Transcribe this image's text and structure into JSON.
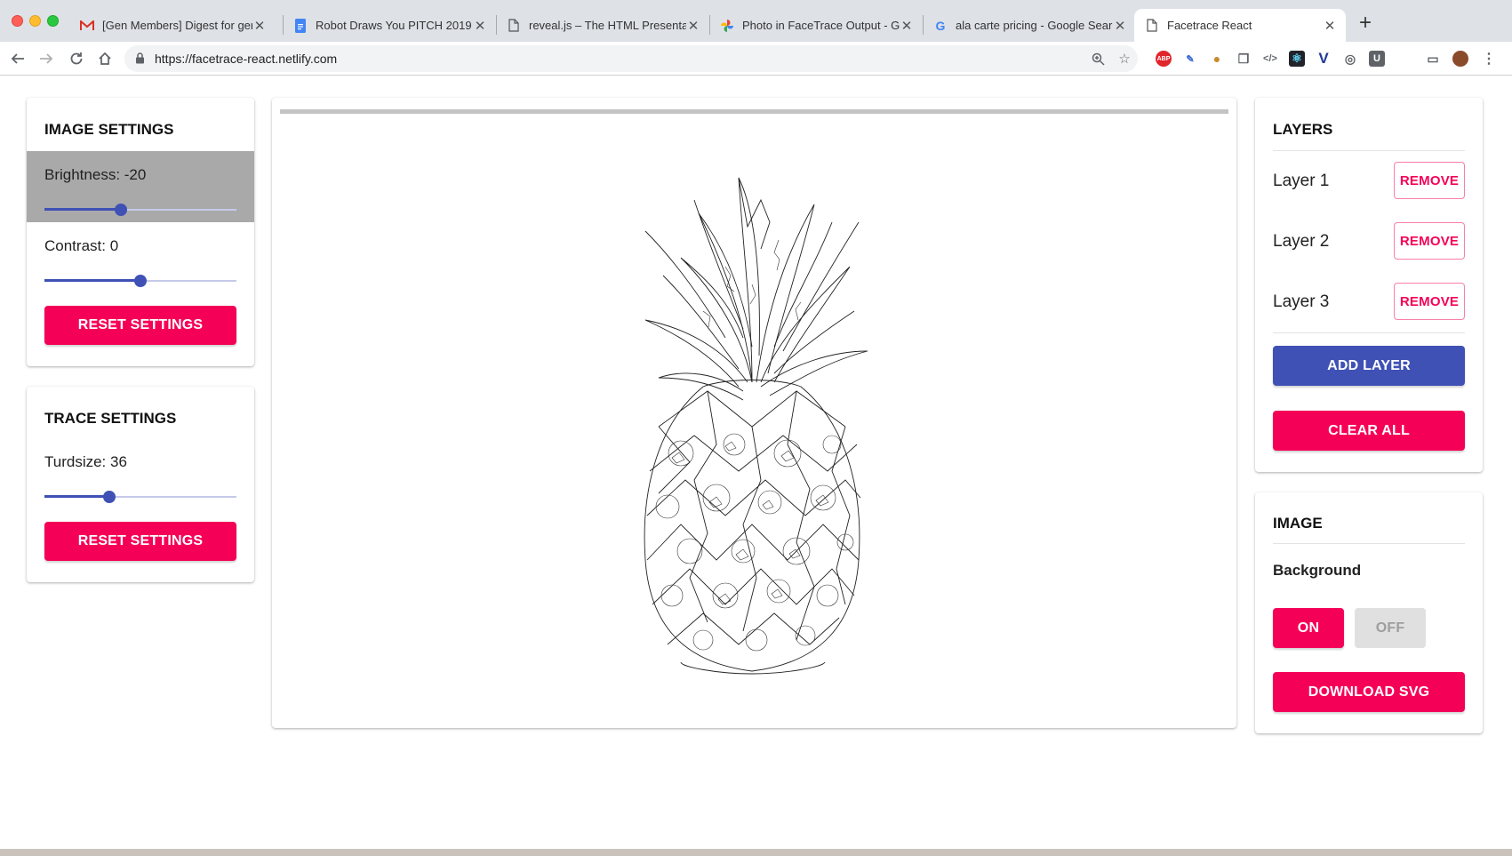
{
  "browser": {
    "tabs": [
      {
        "title": "[Gen Members] Digest for gen",
        "icon": "gmail-icon"
      },
      {
        "title": "Robot Draws You PITCH 2019 -",
        "icon": "google-docs-icon"
      },
      {
        "title": "reveal.js – The HTML Presentat",
        "icon": "page-icon"
      },
      {
        "title": "Photo in FaceTrace Output - Go",
        "icon": "google-photos-icon"
      },
      {
        "title": "ala carte pricing - Google Sear",
        "icon": "google-icon"
      },
      {
        "title": "Facetrace React",
        "icon": "page-icon"
      }
    ],
    "url": "https://facetrace-react.netlify.com",
    "extensions": [
      "ABP",
      "eyedropper",
      "cookie",
      "copy",
      "code",
      "react",
      "V",
      "circle",
      "U"
    ]
  },
  "image_settings": {
    "title": "IMAGE SETTINGS",
    "brightness_label": "Brightness: -20",
    "brightness_level": 0.4,
    "contrast_label": "Contrast: 0",
    "contrast_level": 0.5,
    "reset_label": "RESET SETTINGS"
  },
  "trace_settings": {
    "title": "TRACE SETTINGS",
    "turdsize_label": "Turdsize: 36",
    "turdsize_level": 0.34,
    "reset_label": "RESET SETTINGS"
  },
  "layers": {
    "title": "LAYERS",
    "items": [
      {
        "name": "Layer 1",
        "remove_label": "REMOVE"
      },
      {
        "name": "Layer 2",
        "remove_label": "REMOVE"
      },
      {
        "name": "Layer 3",
        "remove_label": "REMOVE"
      }
    ],
    "add_label": "ADD LAYER",
    "clear_label": "CLEAR ALL"
  },
  "image_panel": {
    "title": "IMAGE",
    "background_label": "Background",
    "on_label": "ON",
    "off_label": "OFF",
    "download_label": "DOWNLOAD SVG"
  },
  "colors": {
    "primary": "#3f51b5",
    "secondary": "#f50057",
    "disabled": "#e0e0e0"
  }
}
